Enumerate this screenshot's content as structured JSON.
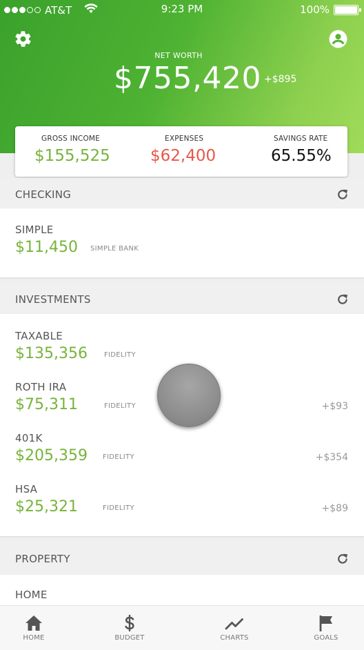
{
  "status": {
    "carrier": "AT&T",
    "time": "9:23 PM",
    "battery": "100%",
    "signal_bars": 3,
    "signal_total": 5
  },
  "header": {
    "net_worth_label": "NET WORTH",
    "net_worth_value": "$755,420",
    "net_worth_change": "+$895",
    "icons": [
      "gear-icon",
      "account-icon"
    ]
  },
  "summary": {
    "gross_income_label": "GROSS INCOME",
    "gross_income_value": "$155,525",
    "expenses_label": "EXPENSES",
    "expenses_value": "$62,400",
    "savings_rate_label": "SAVINGS RATE",
    "savings_rate_value": "65.55%"
  },
  "colors": {
    "brand_green": "#4eb232",
    "income_green": "#78b33a",
    "expense_red": "#e8574a"
  },
  "checking": {
    "title": "CHECKING",
    "accounts": [
      {
        "name": "SIMPLE",
        "value": "$11,450",
        "institution": "SIMPLE BANK",
        "change": ""
      }
    ]
  },
  "investments": {
    "title": "INVESTMENTS",
    "accounts": [
      {
        "name": "TAXABLE",
        "value": "$135,356",
        "institution": "FIDELITY",
        "change": ""
      },
      {
        "name": "ROTH IRA",
        "value": "$75,311",
        "institution": "FIDELITY",
        "change": "+$93"
      },
      {
        "name": "401K",
        "value": "$205,359",
        "institution": "FIDELITY",
        "change": "+$354"
      },
      {
        "name": "HSA",
        "value": "$25,321",
        "institution": "FIDELITY",
        "change": "+$89"
      }
    ]
  },
  "property": {
    "title": "PROPERTY",
    "accounts": [
      {
        "name": "HOME"
      }
    ]
  },
  "tabs": [
    {
      "label": "HOME",
      "icon": "home-icon",
      "active": true
    },
    {
      "label": "BUDGET",
      "icon": "dollar-icon",
      "active": false
    },
    {
      "label": "CHARTS",
      "icon": "chart-icon",
      "active": false
    },
    {
      "label": "GOALS",
      "icon": "flag-icon",
      "active": false
    }
  ]
}
